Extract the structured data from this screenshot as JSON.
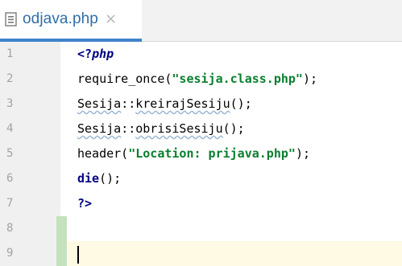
{
  "tab": {
    "filename": "odjava.php",
    "close_glyph": "×",
    "icon": "document-icon"
  },
  "editor": {
    "line_numbers": [
      "1",
      "2",
      "3",
      "4",
      "5",
      "6",
      "7",
      "8",
      "9"
    ],
    "lines": {
      "l1_open": "<?",
      "l1_php": "php",
      "l2_fn": "require_once(",
      "l2_str": "\"sesija.class.php\"",
      "l2_end": ");",
      "l3_class": "Sesija",
      "l3_sep": "::",
      "l3_method": "kreirajSesiju",
      "l3_end": "();",
      "l4_class": "Sesija",
      "l4_sep": "::",
      "l4_method": "obrisiSesiju",
      "l4_end": "();",
      "l5_fn": "header(",
      "l5_str": "\"Location: prijava.php\"",
      "l5_end": ");",
      "l6_kw": "die",
      "l6_end": "();",
      "l7_close": "?>"
    }
  },
  "colors": {
    "tab_accent": "#4083c9",
    "keyword": "#000080",
    "string": "#0a7f2e",
    "current_line": "#fffae3",
    "gutter_marker": "#c4e2bd"
  }
}
